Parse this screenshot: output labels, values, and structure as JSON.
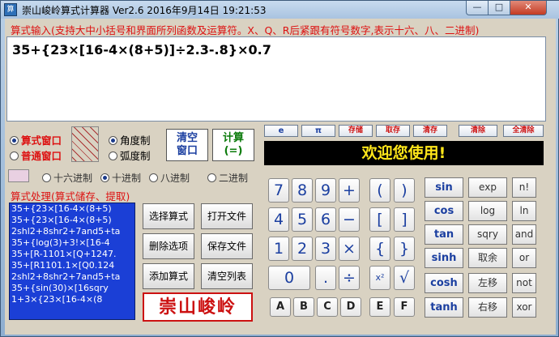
{
  "window": {
    "icon_label": "算",
    "title": "崇山峻岭算式计算器 Ver2.6   2016年9月14日  19:21:53",
    "minimize": "—",
    "maximize": "□",
    "close": "✕"
  },
  "input": {
    "hint": "算式输入(支持大中小括号和界面所列函数及运算符。X、Q、R后紧跟有符号数字,表示十六、八、二进制)",
    "expression": "35+{23×[16-4×(8+5)]÷2.3-.8}×0.7"
  },
  "mode": {
    "formula_window": "算式窗口",
    "normal_window": "普通窗口",
    "degree": "角度制",
    "radian": "弧度制",
    "clear_window_1": "清空",
    "clear_window_2": "窗口",
    "calc_1": "计算",
    "calc_2": "(=)",
    "small_buttons": [
      "e",
      "π",
      "存储",
      "取存",
      "清存",
      "清除",
      "全清除"
    ],
    "display": "欢迎您使用!"
  },
  "base": {
    "hex": "十六进制",
    "dec": "十进制",
    "oct": "八进制",
    "bin": "二进制"
  },
  "formula_panel": {
    "title": "算式处理(算式储存、提取)",
    "items": [
      "35+{23×[16-4×(8+5)",
      "35+{23×[16-4×(8+5)",
      "2shl2+8shr2+7and5+ta",
      "35+{log(3)+3!×[16-4",
      "35+[R-1101×[Q+1247.",
      "35+[R1101.1×[Q0.124",
      "2shl2+8shr2+7and5+ta",
      "35+{sin(30)×[16sqry",
      "1+3×{23×[16-4×(8"
    ],
    "select": "选择算式",
    "open_file": "打开文件",
    "delete": "删除选项",
    "save_file": "保存文件",
    "add": "添加算式",
    "clear_list": "清空列表",
    "stamp": "崇山峻岭"
  },
  "keypad": {
    "digits": [
      "7",
      "8",
      "9",
      "+",
      "4",
      "5",
      "6",
      "−",
      "1",
      "2",
      "3",
      "×",
      "0",
      ".",
      "÷"
    ],
    "brackets": [
      "(",
      ")",
      "[",
      "]",
      "{",
      "}",
      "x²",
      "√"
    ],
    "hex": [
      "A",
      "B",
      "C",
      "D",
      "E",
      "F"
    ]
  },
  "functions": [
    "sin",
    "exp",
    "n!",
    "cos",
    "log",
    "ln",
    "tan",
    "sqry",
    "and",
    "sinh",
    "取余",
    "or",
    "cosh",
    "左移",
    "not",
    "tanh",
    "右移",
    "xor"
  ]
}
